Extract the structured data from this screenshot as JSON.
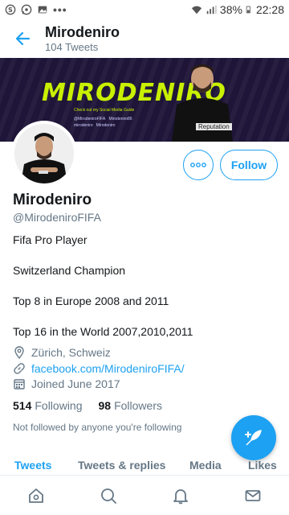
{
  "status_bar": {
    "left_icons": [
      "skype-icon",
      "whatsapp-icon",
      "image-icon",
      "more-dots-icon"
    ],
    "battery": "38%",
    "time": "22:28"
  },
  "header": {
    "name": "Mirodeniro",
    "tweet_count": "104 Tweets"
  },
  "banner": {
    "logo_text": "MIRODENIRO",
    "subtitle": "Check out my Social Media Guide",
    "socials": [
      "@MirodeniroFIFA",
      "Mirodeniro86",
      "mirodeniro",
      "Mirodeniro"
    ],
    "shirt_text": "Reputation"
  },
  "actions": {
    "follow_label": "Follow"
  },
  "profile": {
    "name": "Mirodeniro",
    "handle": "@MirodeniroFIFA",
    "bio": [
      "Fifa Pro Player",
      "Switzerland Champion",
      "Top 8 in Europe 2008 and 2011",
      "Top 16 in the World 2007,2010,2011"
    ],
    "location": "Zürich, Schweiz",
    "website": "facebook.com/MirodeniroFIFA/",
    "joined": "Joined June 2017",
    "following_count": "514",
    "following_label": "Following",
    "followers_count": "98",
    "followers_label": "Followers",
    "not_followed": "Not followed by anyone you're following"
  },
  "tabs": [
    "Tweets",
    "Tweets & replies",
    "Media",
    "Likes"
  ],
  "colors": {
    "accent": "#1da1f2",
    "banner_bg": "#1e1538",
    "banner_logo": "#c8f000"
  },
  "bottom_nav": [
    "home-icon",
    "search-icon",
    "notifications-icon",
    "messages-icon"
  ]
}
